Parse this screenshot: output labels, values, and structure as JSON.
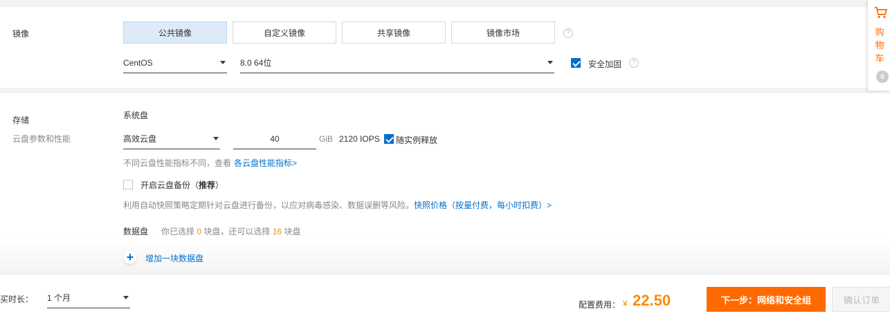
{
  "image_section": {
    "label": "镜像",
    "tabs": [
      {
        "label": "公共镜像",
        "active": true
      },
      {
        "label": "自定义镜像",
        "active": false
      },
      {
        "label": "共享镜像",
        "active": false
      },
      {
        "label": "镜像市场",
        "active": false
      }
    ],
    "os_select": "CentOS",
    "version_select": "8.0 64位",
    "security_label": "安全加固"
  },
  "storage_section": {
    "label": "存储",
    "sublabel": "云盘参数和性能",
    "system_disk_label": "系统盘",
    "disk_type": "高效云盘",
    "disk_size": "40",
    "unit": "GiB",
    "iops": "2120 IOPS",
    "release_label": "随实例释放",
    "perf_note": "不同云盘性能指标不同，查看",
    "perf_link": "各云盘性能指标>",
    "backup_label": "开启云盘备份（",
    "backup_bold": "推荐",
    "backup_close": "）",
    "backup_desc": "利用自动快照策略定期针对云盘进行备份，以应对病毒感染、数据误删等风险。",
    "backup_link": "快照价格（按量付费，每小时扣费）>",
    "data_disk_label": "数据盘",
    "data_disk_prefix": "你已选择",
    "selected_count": "0",
    "data_disk_mid": "块盘，还可以选择",
    "remaining_count": "16",
    "data_disk_suffix": "块盘",
    "add_disk_label": "增加一块数据盘"
  },
  "footer": {
    "duration_label": "购买时长：",
    "duration_value": "1 个月",
    "fee_label": "配置费用：",
    "currency": "¥",
    "price": "22.50",
    "next_button": "下一步：网络和安全组",
    "confirm_button": "确认订单"
  },
  "cart": {
    "label_chars": [
      "购",
      "物",
      "车"
    ],
    "count": "0"
  },
  "colors": {
    "accent_blue": "#0070cc",
    "orange": "#ff6a00",
    "price_orange": "#ff8a00"
  }
}
